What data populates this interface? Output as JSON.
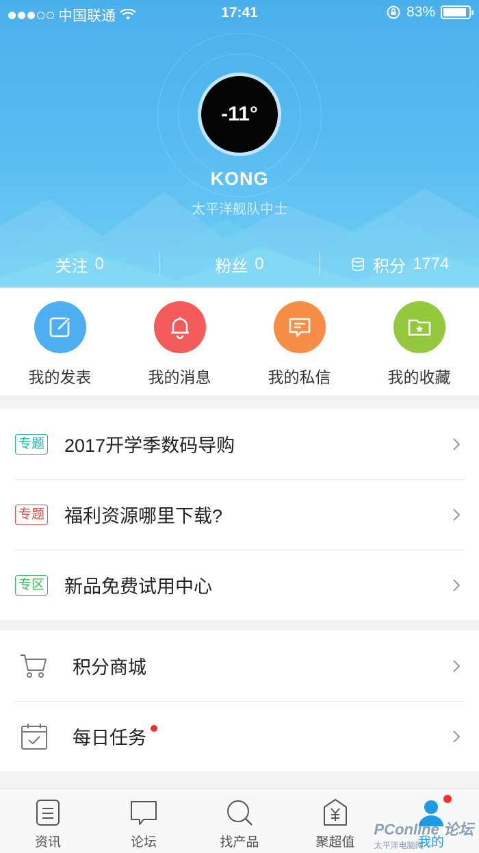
{
  "status_bar": {
    "carrier": "中国联通",
    "time": "17:41",
    "battery": "83%"
  },
  "profile": {
    "avatar_text": "-11°",
    "username": "KONG",
    "rank": "太平洋舰队中士"
  },
  "stats": [
    {
      "label": "关注",
      "value": "0"
    },
    {
      "label": "粉丝",
      "value": "0"
    },
    {
      "label": "积分",
      "value": "1774"
    }
  ],
  "quick_actions": [
    {
      "label": "我的发表",
      "color": "#4daef2"
    },
    {
      "label": "我的消息",
      "color": "#f35a5a"
    },
    {
      "label": "我的私信",
      "color": "#f88d45"
    },
    {
      "label": "我的收藏",
      "color": "#94c83d"
    }
  ],
  "topics": [
    {
      "tag": "专题",
      "tag_color": "#21b5a4",
      "title": "2017开学季数码导购"
    },
    {
      "tag": "专题",
      "tag_color": "#e84c4c",
      "title": "福利资源哪里下载?"
    },
    {
      "tag": "专区",
      "tag_color": "#3bb85a",
      "title": "新品免费试用中心"
    }
  ],
  "services": [
    {
      "icon": "cart-icon",
      "title": "积分商城"
    },
    {
      "icon": "calendar-check-icon",
      "title": "每日任务"
    }
  ],
  "tabs": [
    {
      "label": "资讯",
      "icon": "news-icon"
    },
    {
      "label": "论坛",
      "icon": "chat-icon"
    },
    {
      "label": "找产品",
      "icon": "search-icon"
    },
    {
      "label": "聚超值",
      "icon": "yuan-tag-icon"
    },
    {
      "label": "我的",
      "icon": "person-icon",
      "active": true
    }
  ],
  "watermark": {
    "main": "PConline",
    "sub": "太平洋电脑网",
    "suffix": "论坛"
  }
}
